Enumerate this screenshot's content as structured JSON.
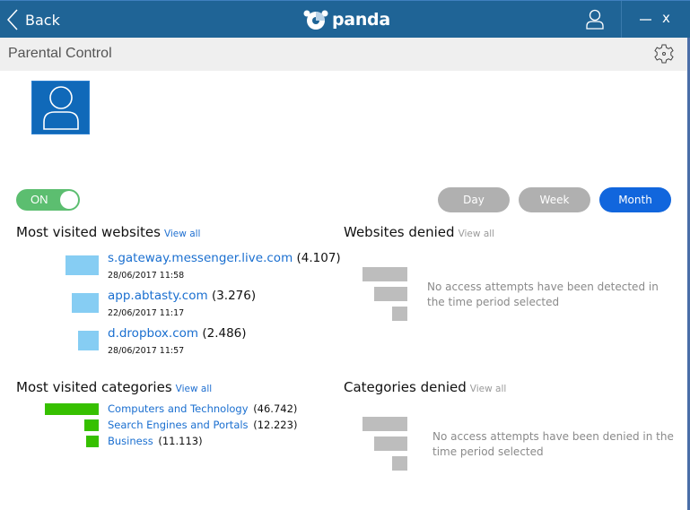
{
  "titlebar": {
    "back_label": "Back",
    "brand": "panda",
    "icons": {
      "back": "chevron-left-icon",
      "logo": "panda-logo-icon",
      "user": "user-icon",
      "minimize": "minimize-icon",
      "close": "close-icon"
    },
    "close_label": "x"
  },
  "subheader": {
    "title": "Parental Control",
    "settings_icon": "gear-icon"
  },
  "profile": {
    "avatar_icon": "user-icon"
  },
  "toggle": {
    "label": "ON",
    "state": true,
    "color": "#5cbe70"
  },
  "period": {
    "options": [
      "Day",
      "Week",
      "Month"
    ],
    "selected": "Month",
    "active_color": "#1166dd",
    "inactive_color": "#b0b0b0"
  },
  "most_visited_websites": {
    "title": "Most visited websites",
    "view_all": "View all",
    "bar_color": "#86cdf3",
    "items": [
      {
        "site": "s.gateway.messenger.live.com",
        "count": "(4.107)",
        "visits": 4107,
        "date": "28/06/2017 11:58"
      },
      {
        "site": "app.abtasty.com",
        "count": "(3.276)",
        "visits": 3276,
        "date": "22/06/2017 11:17"
      },
      {
        "site": "d.dropbox.com",
        "count": "(2.486)",
        "visits": 2486,
        "date": "28/06/2017 11:57"
      }
    ]
  },
  "websites_denied": {
    "title": "Websites denied",
    "view_all": "View all",
    "empty_message": "No access attempts have been detected in the time period selected"
  },
  "most_visited_categories": {
    "title": "Most visited categories",
    "view_all": "View all",
    "bar_color": "#36c000",
    "items": [
      {
        "category": "Computers and Technology",
        "count": "(46.742)",
        "visits": 46742
      },
      {
        "category": "Search Engines and Portals",
        "count": "(12.223)",
        "visits": 12223
      },
      {
        "category": "Business",
        "count": "(11.113)",
        "visits": 11113
      }
    ]
  },
  "categories_denied": {
    "title": "Categories denied",
    "view_all": "View all",
    "empty_message": "No access attempts have been denied in the time period selected"
  }
}
